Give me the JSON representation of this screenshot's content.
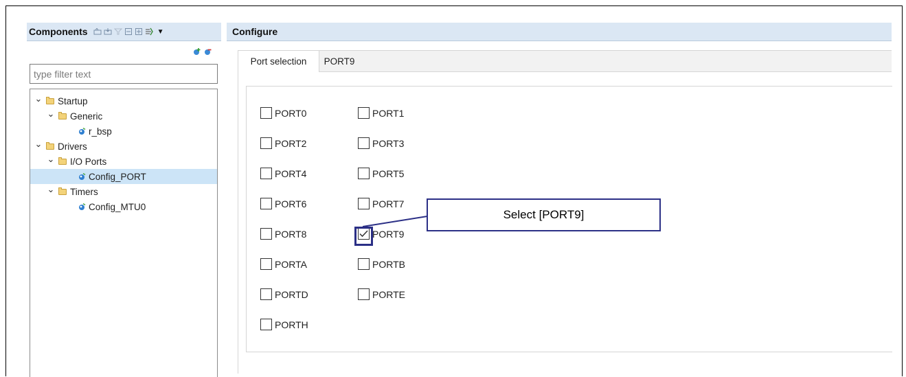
{
  "left_panel": {
    "title": "Components",
    "toolbar_icons": [
      "expand-icon",
      "collapse-icon",
      "filter-icon",
      "minus-icon",
      "plus-icon",
      "generate-icon"
    ],
    "filter_placeholder": "type filter text",
    "tree": [
      {
        "label": "Startup",
        "level": 0,
        "type": "folder",
        "expanded": true
      },
      {
        "label": "Generic",
        "level": 1,
        "type": "folder",
        "expanded": true
      },
      {
        "label": "r_bsp",
        "level": 2,
        "type": "component"
      },
      {
        "label": "Drivers",
        "level": 0,
        "type": "folder",
        "expanded": true
      },
      {
        "label": "I/O Ports",
        "level": 1,
        "type": "folder",
        "expanded": true
      },
      {
        "label": "Config_PORT",
        "level": 2,
        "type": "component",
        "selected": true
      },
      {
        "label": "Timers",
        "level": 1,
        "type": "folder",
        "expanded": true
      },
      {
        "label": "Config_MTU0",
        "level": 2,
        "type": "component"
      }
    ]
  },
  "right_panel": {
    "title": "Configure",
    "tabs": [
      {
        "label": "Port selection",
        "active": true
      },
      {
        "label": "PORT9",
        "active": false
      }
    ],
    "ports": [
      {
        "label": "PORT0",
        "checked": false
      },
      {
        "label": "PORT1",
        "checked": false
      },
      {
        "label": "PORT2",
        "checked": false
      },
      {
        "label": "PORT3",
        "checked": false
      },
      {
        "label": "PORT4",
        "checked": false
      },
      {
        "label": "PORT5",
        "checked": false
      },
      {
        "label": "PORT6",
        "checked": false
      },
      {
        "label": "PORT7",
        "checked": false
      },
      {
        "label": "PORT8",
        "checked": false
      },
      {
        "label": "PORT9",
        "checked": true
      },
      {
        "label": "PORTA",
        "checked": false
      },
      {
        "label": "PORTB",
        "checked": false
      },
      {
        "label": "PORTD",
        "checked": false
      },
      {
        "label": "PORTE",
        "checked": false
      },
      {
        "label": "PORTH",
        "checked": false
      }
    ]
  },
  "annotation": {
    "callout_text": "Select [PORT9]",
    "color": "#2b2f86"
  },
  "colors": {
    "header_bg": "#dbe7f4",
    "selected_row": "#cce4f7"
  }
}
